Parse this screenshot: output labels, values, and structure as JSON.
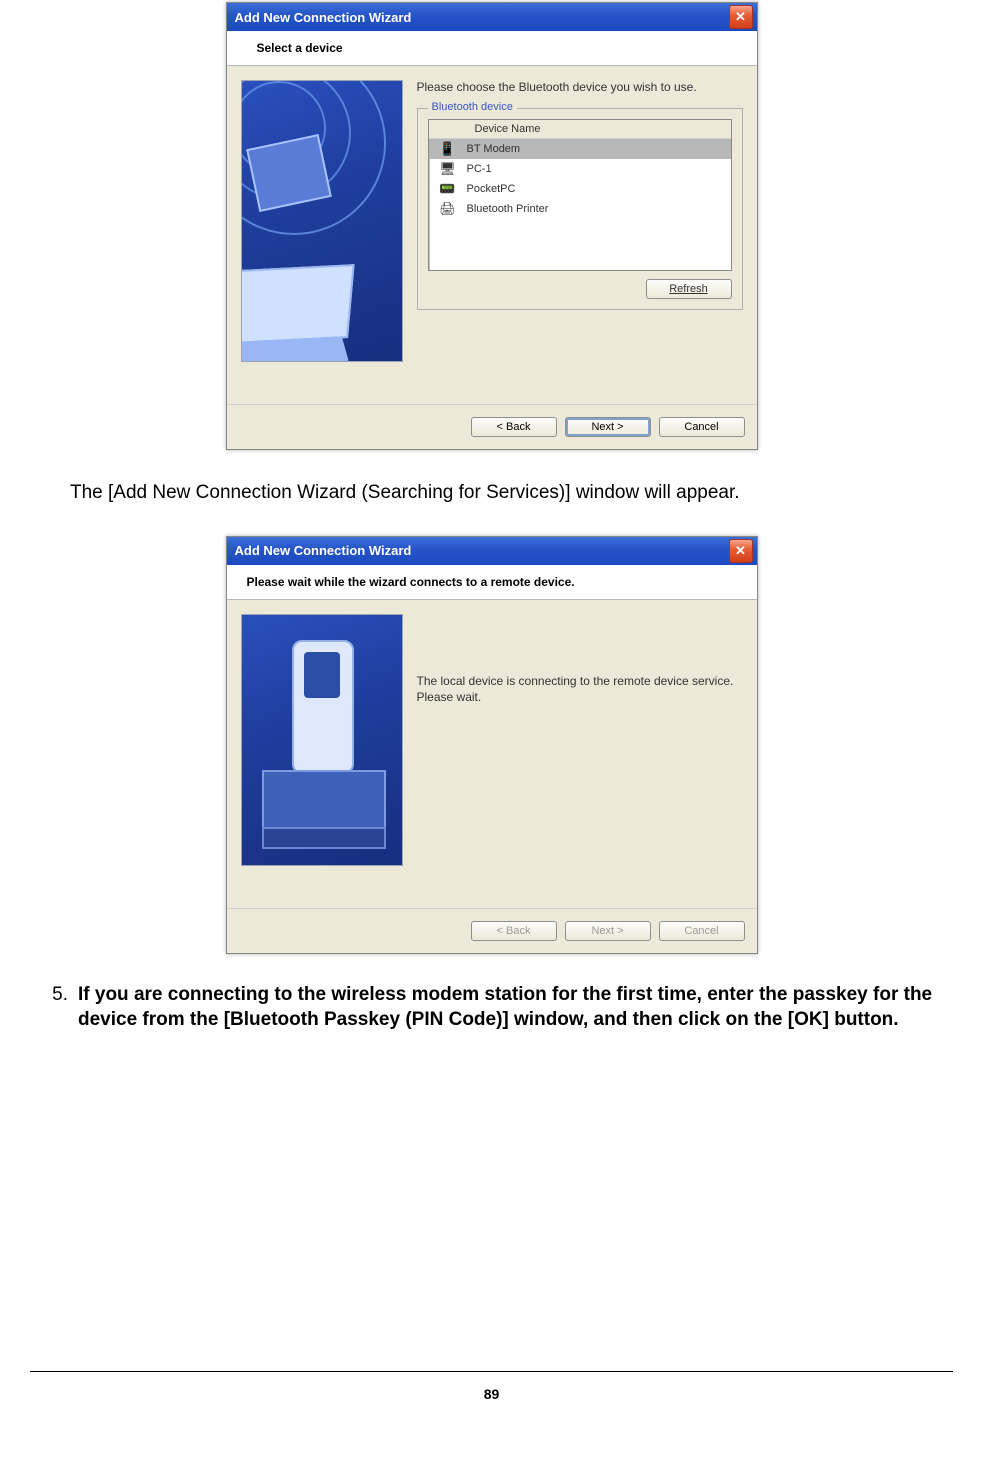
{
  "dialog1": {
    "title": "Add New Connection Wizard",
    "header": "Select a device",
    "prompt": "Please choose the Bluetooth device you wish to use.",
    "group_legend": "Bluetooth device",
    "list_header": "Device Name",
    "devices": [
      {
        "name": "BT Modem",
        "icon": "📱",
        "selected": true
      },
      {
        "name": "PC-1",
        "icon": "🖥",
        "selected": false
      },
      {
        "name": "PocketPC",
        "icon": "📟",
        "selected": false
      },
      {
        "name": "Bluetooth Printer",
        "icon": "🖨",
        "selected": false
      }
    ],
    "refresh": "Refresh",
    "back": "< Back",
    "next": "Next >",
    "cancel": "Cancel"
  },
  "narrative1": "The [Add New Connection Wizard (Searching for Services)] window will appear.",
  "dialog2": {
    "title": "Add New Connection Wizard",
    "header": "Please wait while the wizard connects to a remote device.",
    "msg_line1": "The local device is connecting to the remote device service.",
    "msg_line2": "Please wait.",
    "back": "< Back",
    "next": "Next >",
    "cancel": "Cancel"
  },
  "step5": {
    "number": "5.",
    "text": "If you are connecting to the wireless modem station for the first time, enter the passkey for the device from the [Bluetooth Passkey (PIN Code)] window, and then click on the [OK] button."
  },
  "page_number": "89"
}
